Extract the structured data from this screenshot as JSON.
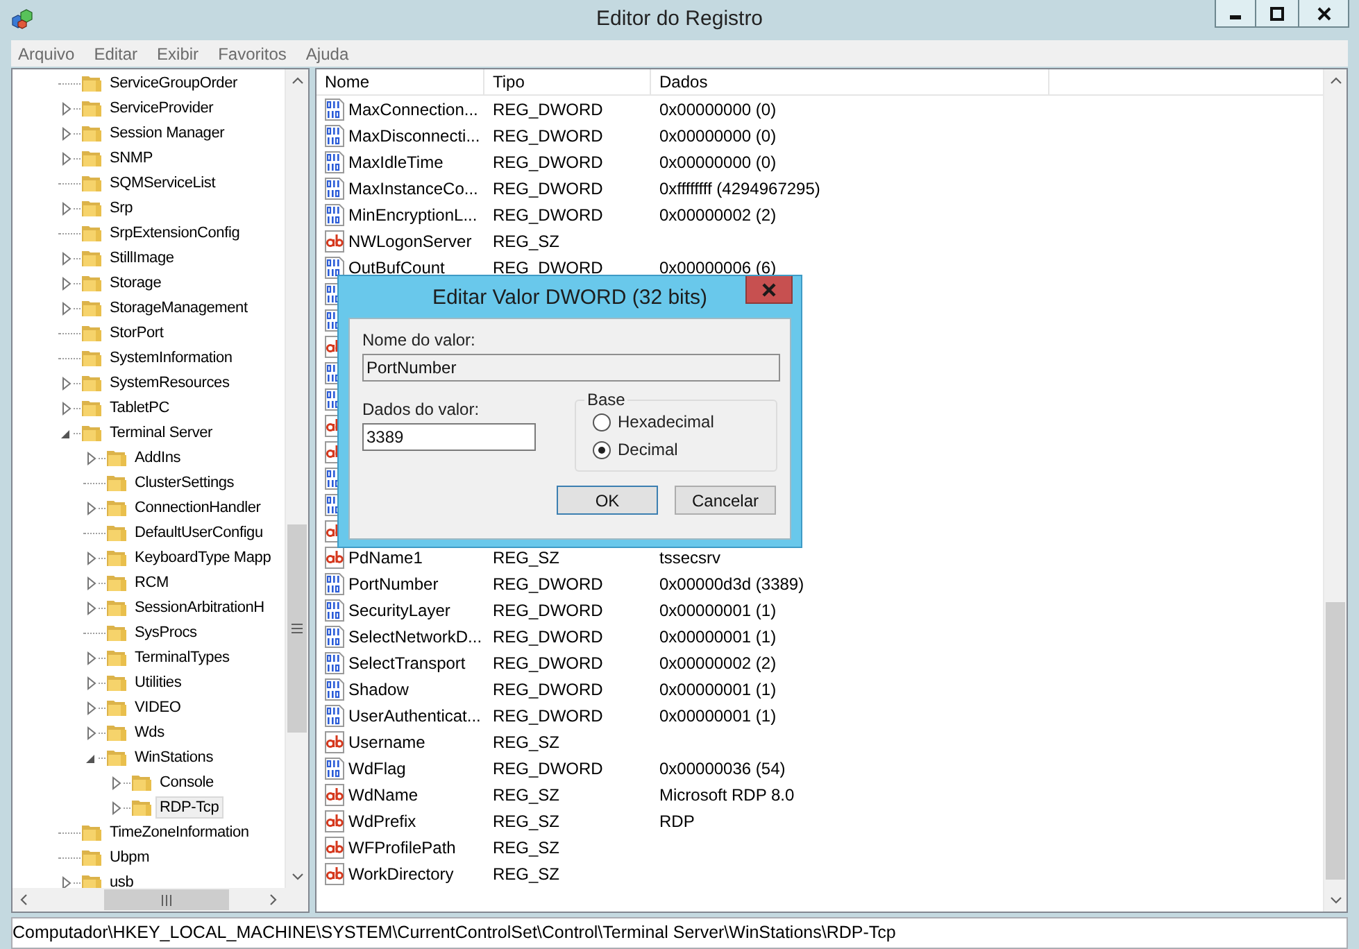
{
  "window": {
    "title": "Editor do Registro"
  },
  "menu": [
    "Arquivo",
    "Editar",
    "Exibir",
    "Favoritos",
    "Ajuda"
  ],
  "tree": [
    {
      "label": "ServiceGroupOrder",
      "expandable": false,
      "selected": false
    },
    {
      "label": "ServiceProvider",
      "expandable": true,
      "expanded": false,
      "selected": false
    },
    {
      "label": "Session Manager",
      "expandable": true,
      "expanded": false,
      "selected": false
    },
    {
      "label": "SNMP",
      "expandable": true,
      "expanded": false,
      "selected": false
    },
    {
      "label": "SQMServiceList",
      "expandable": false,
      "selected": false
    },
    {
      "label": "Srp",
      "expandable": true,
      "expanded": false,
      "selected": false
    },
    {
      "label": "SrpExtensionConfig",
      "expandable": false,
      "selected": false
    },
    {
      "label": "StillImage",
      "expandable": true,
      "expanded": false,
      "selected": false
    },
    {
      "label": "Storage",
      "expandable": true,
      "expanded": false,
      "selected": false
    },
    {
      "label": "StorageManagement",
      "expandable": true,
      "expanded": false,
      "selected": false
    },
    {
      "label": "StorPort",
      "expandable": false,
      "selected": false
    },
    {
      "label": "SystemInformation",
      "expandable": false,
      "selected": false
    },
    {
      "label": "SystemResources",
      "expandable": true,
      "expanded": false,
      "selected": false
    },
    {
      "label": "TabletPC",
      "expandable": true,
      "expanded": false,
      "selected": false
    },
    {
      "label": "Terminal Server",
      "expandable": true,
      "expanded": true,
      "selected": false,
      "children": [
        {
          "label": "AddIns",
          "expandable": true,
          "expanded": false,
          "selected": false
        },
        {
          "label": "ClusterSettings",
          "expandable": false,
          "selected": false
        },
        {
          "label": "ConnectionHandler",
          "expandable": true,
          "expanded": false,
          "selected": false
        },
        {
          "label": "DefaultUserConfigu",
          "expandable": false,
          "selected": false
        },
        {
          "label": "KeyboardType Mapp",
          "expandable": true,
          "expanded": false,
          "selected": false
        },
        {
          "label": "RCM",
          "expandable": true,
          "expanded": false,
          "selected": false
        },
        {
          "label": "SessionArbitrationH",
          "expandable": true,
          "expanded": false,
          "selected": false
        },
        {
          "label": "SysProcs",
          "expandable": false,
          "selected": false
        },
        {
          "label": "TerminalTypes",
          "expandable": true,
          "expanded": false,
          "selected": false
        },
        {
          "label": "Utilities",
          "expandable": true,
          "expanded": false,
          "selected": false
        },
        {
          "label": "VIDEO",
          "expandable": true,
          "expanded": false,
          "selected": false
        },
        {
          "label": "Wds",
          "expandable": true,
          "expanded": false,
          "selected": false
        },
        {
          "label": "WinStations",
          "expandable": true,
          "expanded": true,
          "selected": false,
          "children": [
            {
              "label": "Console",
              "expandable": true,
              "expanded": false,
              "selected": false
            },
            {
              "label": "RDP-Tcp",
              "expandable": true,
              "expanded": false,
              "selected": true
            }
          ]
        }
      ]
    },
    {
      "label": "TimeZoneInformation",
      "expandable": false,
      "selected": false
    },
    {
      "label": "Ubpm",
      "expandable": false,
      "selected": false
    },
    {
      "label": "usb",
      "expandable": true,
      "expanded": false,
      "selected": false
    }
  ],
  "list": {
    "columns": [
      "Nome",
      "Tipo",
      "Dados"
    ],
    "rows": [
      {
        "kind": "dword",
        "name": "MaxConnection...",
        "type": "REG_DWORD",
        "data": "0x00000000 (0)"
      },
      {
        "kind": "dword",
        "name": "MaxDisconnecti...",
        "type": "REG_DWORD",
        "data": "0x00000000 (0)"
      },
      {
        "kind": "dword",
        "name": "MaxIdleTime",
        "type": "REG_DWORD",
        "data": "0x00000000 (0)"
      },
      {
        "kind": "dword",
        "name": "MaxInstanceCo...",
        "type": "REG_DWORD",
        "data": "0xffffffff (4294967295)"
      },
      {
        "kind": "dword",
        "name": "MinEncryptionL...",
        "type": "REG_DWORD",
        "data": "0x00000002 (2)"
      },
      {
        "kind": "sz",
        "name": "NWLogonServer",
        "type": "REG_SZ"
      },
      {
        "kind": "dword",
        "name": "OutBufCount",
        "type": "REG_DWORD",
        "data": "0x00000006 (6)"
      },
      {
        "kind": "dword"
      },
      {
        "kind": "dword"
      },
      {
        "kind": "sz"
      },
      {
        "kind": "dword"
      },
      {
        "kind": "dword"
      },
      {
        "kind": "sz"
      },
      {
        "kind": "sz"
      },
      {
        "kind": "dword"
      },
      {
        "kind": "dword"
      },
      {
        "kind": "sz"
      },
      {
        "kind": "sz",
        "name": "PdName1",
        "type": "REG_SZ",
        "data": "tssecsrv"
      },
      {
        "kind": "dword",
        "name": "PortNumber",
        "type": "REG_DWORD",
        "data": "0x00000d3d (3389)"
      },
      {
        "kind": "dword",
        "name": "SecurityLayer",
        "type": "REG_DWORD",
        "data": "0x00000001 (1)"
      },
      {
        "kind": "dword",
        "name": "SelectNetworkD...",
        "type": "REG_DWORD",
        "data": "0x00000001 (1)"
      },
      {
        "kind": "dword",
        "name": "SelectTransport",
        "type": "REG_DWORD",
        "data": "0x00000002 (2)"
      },
      {
        "kind": "dword",
        "name": "Shadow",
        "type": "REG_DWORD",
        "data": "0x00000001 (1)"
      },
      {
        "kind": "dword",
        "name": "UserAuthenticat...",
        "type": "REG_DWORD",
        "data": "0x00000001 (1)"
      },
      {
        "kind": "sz",
        "name": "Username",
        "type": "REG_SZ"
      },
      {
        "kind": "dword",
        "name": "WdFlag",
        "type": "REG_DWORD",
        "data": "0x00000036 (54)"
      },
      {
        "kind": "sz",
        "name": "WdName",
        "type": "REG_SZ",
        "data": "Microsoft RDP 8.0"
      },
      {
        "kind": "sz",
        "name": "WdPrefix",
        "type": "REG_SZ",
        "data": "RDP"
      },
      {
        "kind": "sz",
        "name": "WFProfilePath",
        "type": "REG_SZ"
      },
      {
        "kind": "sz",
        "name": "WorkDirectory",
        "type": "REG_SZ"
      }
    ]
  },
  "dialog": {
    "title": "Editar Valor DWORD (32 bits)",
    "name_label": "Nome do valor:",
    "name_value": "PortNumber",
    "data_label": "Dados do valor:",
    "data_value": "3389",
    "base_label": "Base",
    "radios": [
      {
        "label": "Hexadecimal",
        "selected": false
      },
      {
        "label": "Decimal",
        "selected": true
      }
    ],
    "buttons": [
      {
        "label": "OK",
        "default": true
      },
      {
        "label": "Cancelar",
        "default": false
      }
    ]
  },
  "status_bar": {
    "path": "Computador\\HKEY_LOCAL_MACHINE\\SYSTEM\\CurrentControlSet\\Control\\Terminal Server\\WinStations\\RDP-Tcp"
  }
}
